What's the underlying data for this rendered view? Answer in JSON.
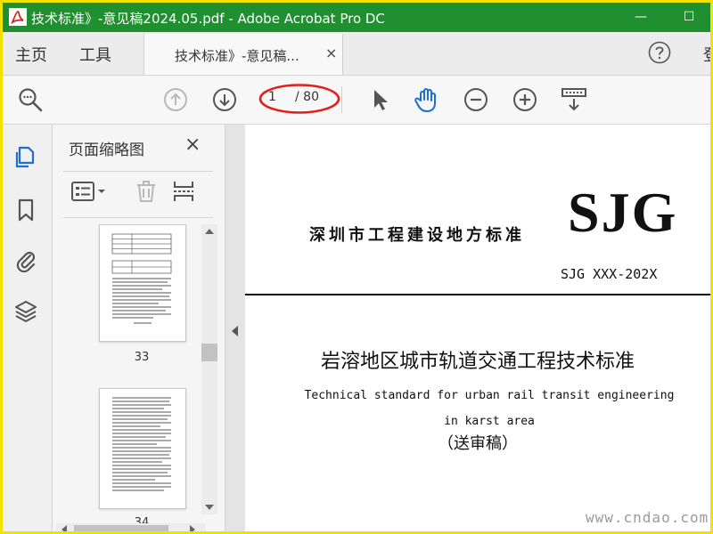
{
  "titlebar": {
    "title": "技术标准》-意见稿2024.05.pdf - Adobe Acrobat Pro DC",
    "logo_icon": "acrobat-logo-icon",
    "minimize_symbol": "—",
    "maximize_symbol": "☐"
  },
  "menu": {
    "home_label": "主页",
    "tools_label": "工具",
    "tab_label": "技术标准》-意见稿...",
    "tab_close": "×",
    "help_icon": "help-icon",
    "clipped_text": "登"
  },
  "toolbar": {
    "current_page": "1",
    "total_pages": "/ 80",
    "highlight_color": "#e0201c"
  },
  "thumbnails": {
    "title": "页面缩略图",
    "close": "×",
    "pages": [
      {
        "label": "33"
      },
      {
        "label": "34"
      }
    ]
  },
  "document": {
    "std_org": "深圳市工程建设地方标准",
    "logo": "SJG",
    "code": "SJG XXX-202X",
    "title_cn": "岩溶地区城市轨道交通工程技术标准",
    "title_en": "Technical standard for urban rail transit engineering in karst area",
    "draft": "（送审稿）"
  },
  "watermark": "www.cndao.com",
  "colors": {
    "titlebar": "#1f8f2f",
    "accent_blue": "#1a6fd0",
    "frame": "#f2e200"
  }
}
